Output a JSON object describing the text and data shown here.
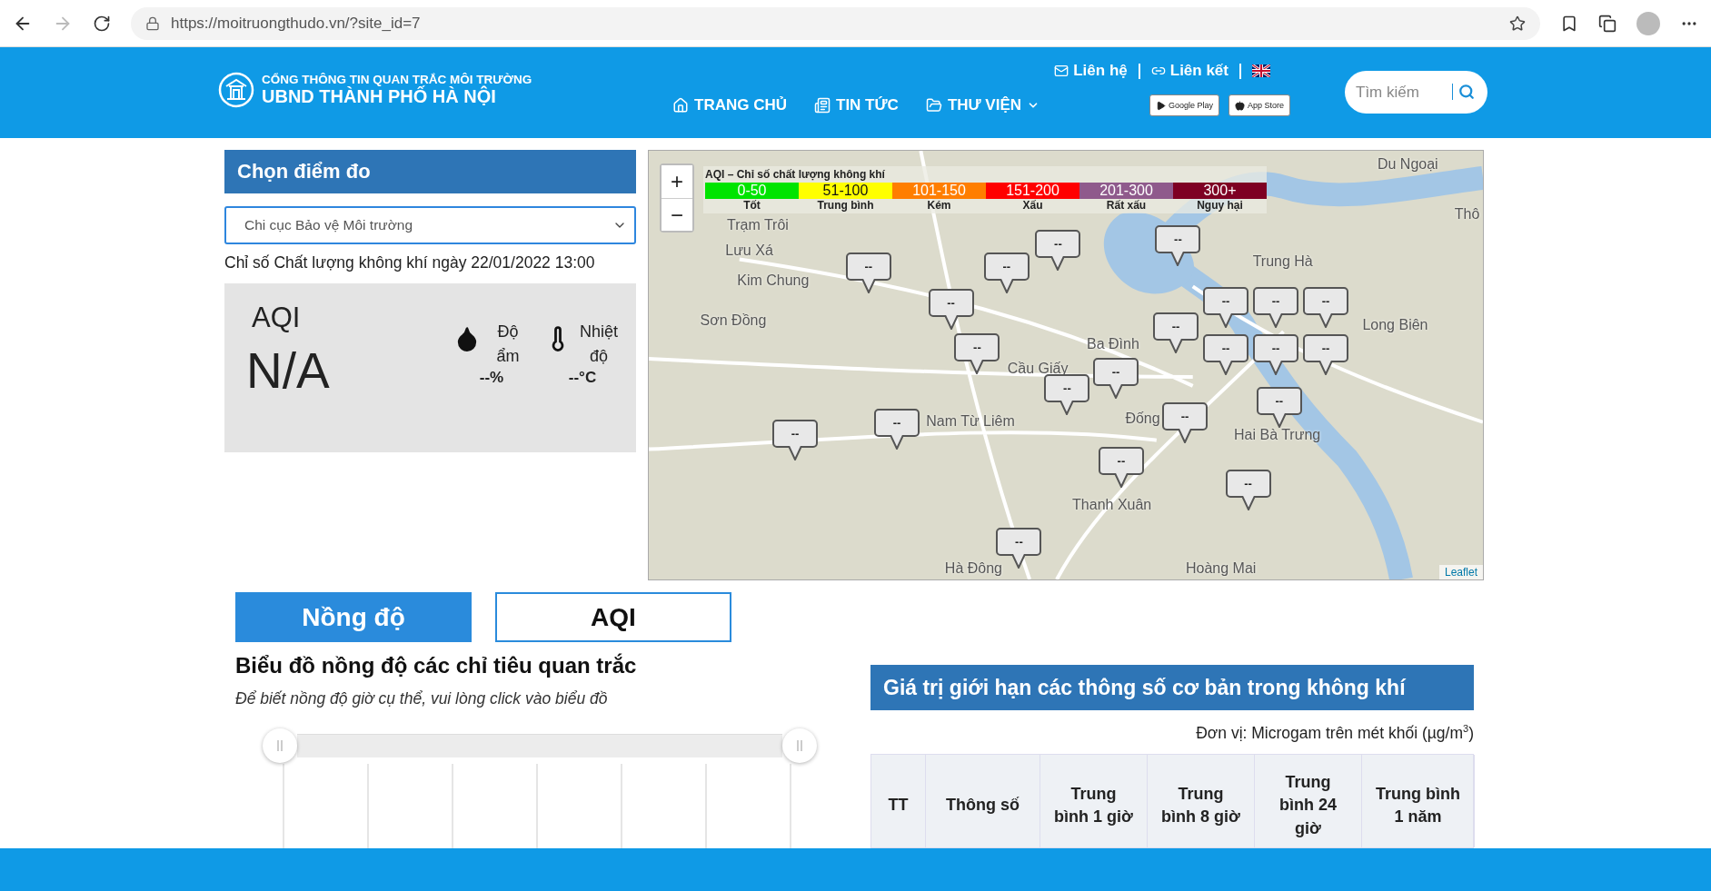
{
  "browser": {
    "url": "https://moitruongthudo.vn/?site_id=7",
    "forward_disabled": true
  },
  "header": {
    "org_line": "CỔNG THÔNG TIN QUAN TRẮC MÔI TRƯỜNG",
    "city_line": "UBND THÀNH PHỐ HÀ NỘI",
    "top_links": [
      {
        "label": "Liên hệ",
        "kind": "mail"
      },
      {
        "label": "Liên kết",
        "kind": "link"
      }
    ],
    "nav": [
      {
        "label": "TRANG CHỦ",
        "kind": "home",
        "dropdown": false
      },
      {
        "label": "TIN TỨC",
        "kind": "news",
        "dropdown": false
      },
      {
        "label": "THƯ VIỆN",
        "kind": "folder",
        "dropdown": true
      }
    ],
    "store_badges": [
      {
        "label": "Google Play",
        "kind": "play"
      },
      {
        "label": "App Store",
        "kind": "apple"
      }
    ],
    "search": {
      "placeholder": "Tìm kiếm"
    }
  },
  "station_panel": {
    "title": "Chọn điểm đo",
    "station": "Chi cục Bảo vệ Môi trường",
    "timestamp": "Chỉ số Chất lượng không khí ngày 22/01/2022 13:00",
    "aqi_label": "AQI",
    "aqi_value": "N/A",
    "readings": [
      {
        "kind": "humidity",
        "label": "Độ ẩm",
        "value": "--%"
      },
      {
        "kind": "temperature",
        "label": "Nhiệt độ",
        "value": "--°C"
      }
    ]
  },
  "map": {
    "legend_title": "AQI – Chỉ số chất lượng không khí",
    "legend": [
      {
        "range": "0-50",
        "name": "Tốt",
        "color": "#00e400"
      },
      {
        "range": "51-100",
        "name": "Trung bình",
        "color": "#ffff00"
      },
      {
        "range": "101-150",
        "name": "Kém",
        "color": "#ff7e00"
      },
      {
        "range": "151-200",
        "name": "Xấu",
        "color": "#ff0000"
      },
      {
        "range": "201-300",
        "name": "Rất xấu",
        "color": "#8f5a8c"
      },
      {
        "range": "300+",
        "name": "Nguy hại",
        "color": "#7e0023"
      }
    ],
    "zoom": [
      "+",
      "−"
    ],
    "places": [
      "Du Ngoại",
      "Thô",
      "Trạm Trôi",
      "Lưu Xá",
      "Kim Chung",
      "Sơn Đồng",
      "Trung Hà",
      "Long Biên",
      "Ba Đình",
      "Cầu Giấy",
      "Nam Từ Liêm",
      "Đống",
      "Hai Bà Trưng",
      "Thanh Xuân",
      "Hoàng Mai",
      "Hà Đông"
    ],
    "markers": [
      "--",
      "--",
      "--",
      "--",
      "--",
      "--",
      "--",
      "--",
      "--",
      "--",
      "--",
      "--",
      "--",
      "--",
      "--",
      "--",
      "--",
      "--",
      "--",
      "--",
      "--",
      "--"
    ],
    "attribution": "Leaflet"
  },
  "tabs": [
    {
      "label": "Nồng độ",
      "selected": true
    },
    {
      "label": "AQI",
      "selected": false
    }
  ],
  "chart": {
    "title": "Biểu đồ nồng độ các chỉ tiêu quan trắc",
    "hint": "Để biết nồng độ giờ cụ thể, vui lòng click vào biểu đồ",
    "handles": [
      {
        "level": 0
      },
      {
        "level": 1
      }
    ]
  },
  "limits": {
    "title": "Giá trị giới hạn các thông số cơ bản trong không khí",
    "unit": "Đơn vị: Microgam trên mét khối (µg/m$^{3}$)",
    "columns": [
      "TT",
      "Thông số",
      "Trung bình 1 giờ",
      "Trung bình 8 giờ",
      "Trung bình 24 giờ",
      "Trung bình 1 năm"
    ]
  }
}
